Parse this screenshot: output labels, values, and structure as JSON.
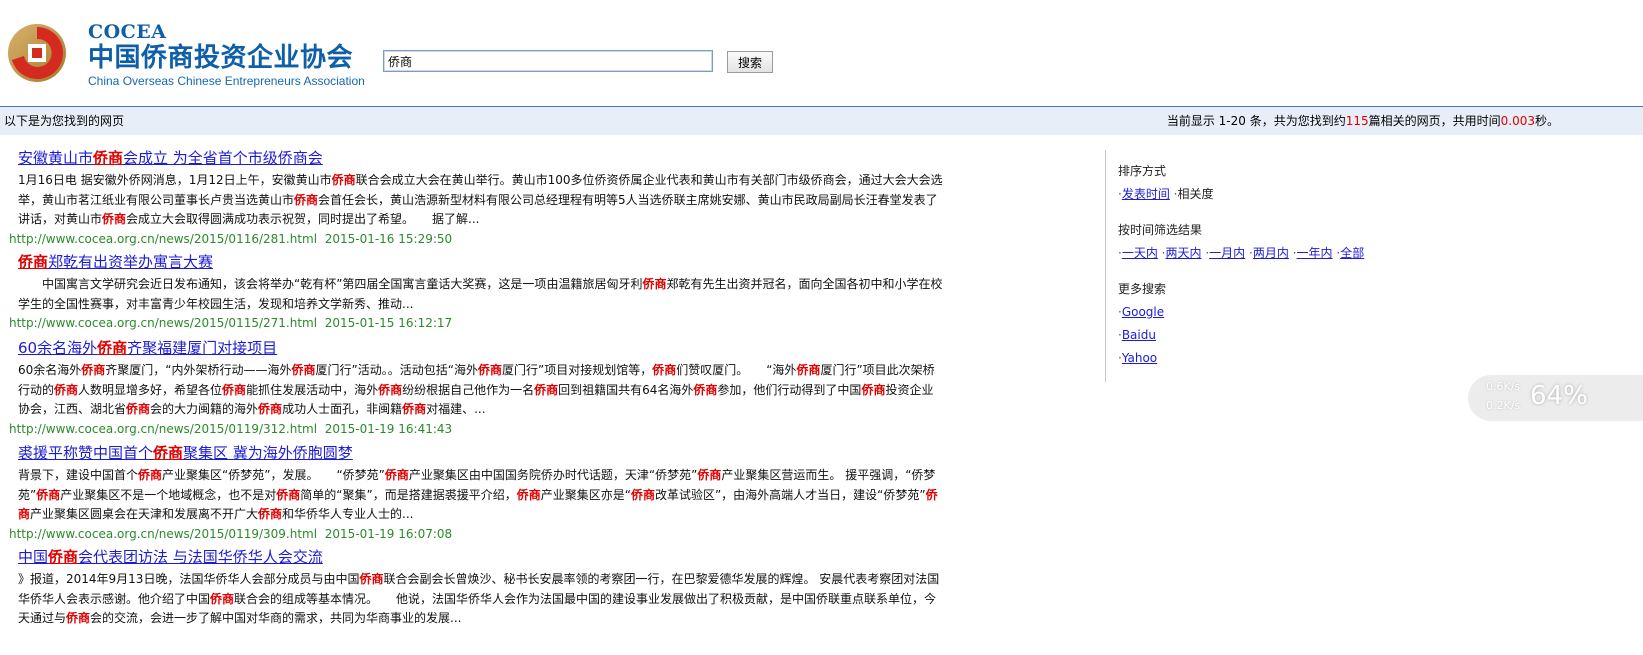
{
  "header": {
    "logo_cocea": "COCEA",
    "logo_cn": "中国侨商投资企业协会",
    "logo_en": "China Overseas Chinese Entrepreneurs Association",
    "search_value": "侨商",
    "search_button": "搜索"
  },
  "summary": {
    "left": "以下是为您找到的网页",
    "right_prefix": "当前显示 1-20 条，共为您找到约",
    "count": "115",
    "right_middle": "篇相关的网页，共用时间",
    "time": "0.003",
    "right_suffix": "秒。"
  },
  "results": [
    {
      "title_pre": "安徽黄山市",
      "title_hl": "侨商",
      "title_post": "会成立 为全省首个市级侨商会",
      "snippet": [
        {
          "t": "1月16日电 据安徽外侨网消息，1月12日上午，安徽黄山市"
        },
        {
          "t": "侨商",
          "hl": true
        },
        {
          "t": "联合会成立大会在黄山举行。黄山市100多位侨资侨属企业代表和黄山市有关部门市级侨商会，通过大会大会选举，黄山市茗江纸业有限公司董事长卢贵当选黄山市"
        },
        {
          "t": "侨商",
          "hl": true
        },
        {
          "t": "会首任会长，黄山浩源新型材料有限公司总经理程有明等5人当选侨联主席姚安娜、黄山市民政局副局长汪春堂发表了讲话，对黄山市"
        },
        {
          "t": "侨商",
          "hl": true
        },
        {
          "t": "会成立大会取得圆满成功表示祝贺，同时提出了希望。　　据了解..."
        }
      ],
      "url": "http://www.cocea.org.cn/news/2015/0116/281.html",
      "date": "2015-01-16 15:29:50"
    },
    {
      "title_pre": "",
      "title_hl": "侨商",
      "title_post": "郑乾有出资举办寓言大赛",
      "snippet": [
        {
          "t": "　　中国寓言文学研究会近日发布通知，该会将举办“乾有杯”第四届全国寓言童话大奖赛，这是一项由温籍旅居匈牙利"
        },
        {
          "t": "侨商",
          "hl": true
        },
        {
          "t": "郑乾有先生出资并冠名，面向全国各初中和小学在校学生的全国性赛事，对丰富青少年校园生活，发现和培养文学新秀、推动..."
        }
      ],
      "url": "http://www.cocea.org.cn/news/2015/0115/271.html",
      "date": "2015-01-15 16:12:17"
    },
    {
      "title_pre": "60余名海外",
      "title_hl": "侨商",
      "title_post": "齐聚福建厦门对接项目",
      "snippet": [
        {
          "t": "60余名海外"
        },
        {
          "t": "侨商",
          "hl": true
        },
        {
          "t": "齐聚厦门，“内外架桥行动——海外"
        },
        {
          "t": "侨商",
          "hl": true
        },
        {
          "t": "厦门行”活动。。活动包括“海外"
        },
        {
          "t": "侨商",
          "hl": true
        },
        {
          "t": "厦门行”项目对接规划馆等，"
        },
        {
          "t": "侨商",
          "hl": true
        },
        {
          "t": "们赞叹厦门。　　“海外"
        },
        {
          "t": "侨商",
          "hl": true
        },
        {
          "t": "厦门行”项目此次架桥行动的"
        },
        {
          "t": "侨商",
          "hl": true
        },
        {
          "t": "人数明显增多好，希望各位"
        },
        {
          "t": "侨商",
          "hl": true
        },
        {
          "t": "能抓住发展活动中，海外"
        },
        {
          "t": "侨商",
          "hl": true
        },
        {
          "t": "纷纷根据自己他作为一名"
        },
        {
          "t": "侨商",
          "hl": true
        },
        {
          "t": "回到祖籍国共有64名海外"
        },
        {
          "t": "侨商",
          "hl": true
        },
        {
          "t": "参加，他们行动得到了中国"
        },
        {
          "t": "侨商",
          "hl": true
        },
        {
          "t": "投资企业协会，江西、湖北省"
        },
        {
          "t": "侨商",
          "hl": true
        },
        {
          "t": "会的大力闽籍的海外"
        },
        {
          "t": "侨商",
          "hl": true
        },
        {
          "t": "成功人士面孔，非闽籍"
        },
        {
          "t": "侨商",
          "hl": true
        },
        {
          "t": "对福建、..."
        }
      ],
      "url": "http://www.cocea.org.cn/news/2015/0119/312.html",
      "date": "2015-01-19 16:41:43"
    },
    {
      "title_pre": "裘援平称赞中国首个",
      "title_hl": "侨商",
      "title_post": "聚集区 冀为海外侨胞圆梦",
      "snippet": [
        {
          "t": "背景下，建设中国首个"
        },
        {
          "t": "侨商",
          "hl": true
        },
        {
          "t": "产业聚集区“侨梦苑”，发展。　　“侨梦苑”"
        },
        {
          "t": "侨商",
          "hl": true
        },
        {
          "t": "产业聚集区由中国国务院侨办时代话题，天津“侨梦苑”"
        },
        {
          "t": "侨商",
          "hl": true
        },
        {
          "t": "产业聚集区营运而生。 援平强调，“侨梦苑”"
        },
        {
          "t": "侨商",
          "hl": true
        },
        {
          "t": "产业聚集区不是一个地域概念，也不是对"
        },
        {
          "t": "侨商",
          "hl": true
        },
        {
          "t": "简单的“聚集”，而是搭建据裘援平介绍，"
        },
        {
          "t": "侨商",
          "hl": true
        },
        {
          "t": "产业聚集区亦是“"
        },
        {
          "t": "侨商",
          "hl": true
        },
        {
          "t": "改革试验区”，由海外高端人才当日，建设“侨梦苑”"
        },
        {
          "t": "侨商",
          "hl": true
        },
        {
          "t": "产业聚集区圆桌会在天津和发展离不开广大"
        },
        {
          "t": "侨商",
          "hl": true
        },
        {
          "t": "和华侨华人专业人士的..."
        }
      ],
      "url": "http://www.cocea.org.cn/news/2015/0119/309.html",
      "date": "2015-01-19 16:07:08"
    },
    {
      "title_pre": "中国",
      "title_hl": "侨商",
      "title_post": "会代表团访法 与法国华侨华人会交流",
      "snippet": [
        {
          "t": "》报道，2014年9月13日晚，法国华侨华人会部分成员与由中国"
        },
        {
          "t": "侨商",
          "hl": true
        },
        {
          "t": "联合会副会长曾焕沙、秘书长安晨率领的考察团一行，在巴黎爱德华发展的辉煌。 安晨代表考察团对法国华侨华人会表示感谢。他介绍了中国"
        },
        {
          "t": "侨商",
          "hl": true
        },
        {
          "t": "联合会的组成等基本情况。　　他说，法国华侨华人会作为法国最中国的建设事业发展做出了积极贡献，是中国侨联重点联系单位，今天通过与"
        },
        {
          "t": "侨商",
          "hl": true
        },
        {
          "t": "会的交流，会进一步了解中国对华商的需求，共同为华商事业的发展..."
        }
      ],
      "url": "",
      "date": ""
    }
  ],
  "sidebar": {
    "sort_heading": "排序方式",
    "sort_time": "发表时间",
    "sort_relevance": "相关度",
    "filter_heading": "按时间筛选结果",
    "filters": [
      "一天内",
      "两天内",
      "一月内",
      "两月内",
      "一年内",
      "全部"
    ],
    "more_heading": "更多搜索",
    "engines": [
      "Google",
      "Baidu",
      "Yahoo"
    ]
  },
  "speed_widget": {
    "up": "0.6K/s",
    "down": "0.2K/s",
    "percent": "64%"
  },
  "colors": {
    "link": "#1c1cd6",
    "highlight": "#e10000",
    "url": "#2b8a2b",
    "brand": "#0e5fa8",
    "summary_bg": "#e8eef8"
  }
}
